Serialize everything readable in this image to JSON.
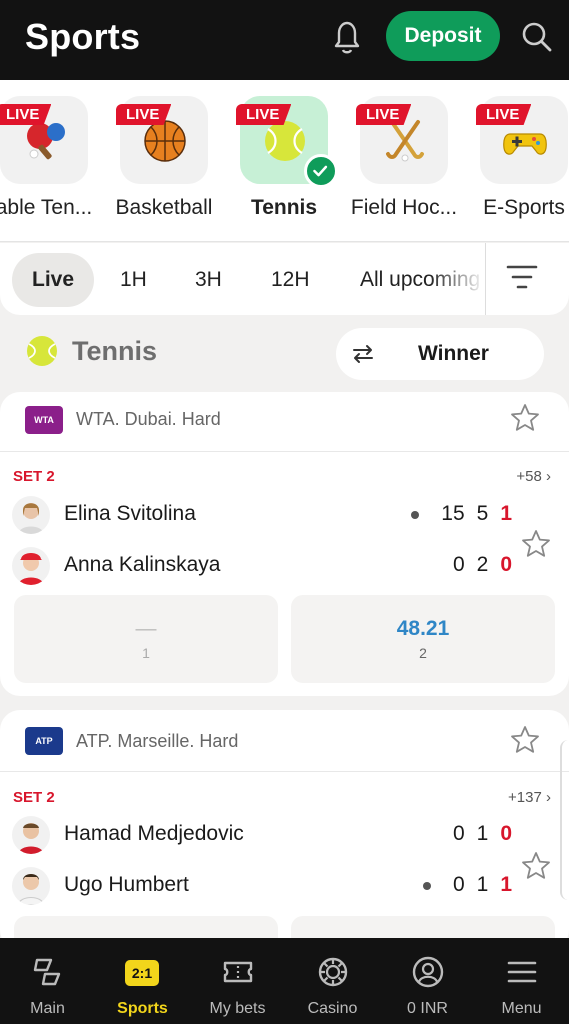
{
  "header": {
    "title": "Sports",
    "deposit_label": "Deposit"
  },
  "sports": [
    {
      "label": "Table Tennis",
      "display": "able Ten...",
      "live": "LIVE",
      "icon": "table-tennis-icon"
    },
    {
      "label": "Basketball",
      "display": "Basketball",
      "live": "LIVE",
      "icon": "basketball-icon"
    },
    {
      "label": "Tennis",
      "display": "Tennis",
      "live": "LIVE",
      "icon": "tennis-ball-icon",
      "selected": true
    },
    {
      "label": "Field Hockey",
      "display": "Field Hoc...",
      "live": "LIVE",
      "icon": "field-hockey-icon"
    },
    {
      "label": "E-Sports",
      "display": "E-Sports",
      "live": "LIVE",
      "icon": "gamepad-icon"
    }
  ],
  "time_filters": [
    {
      "label": "Live",
      "active": true
    },
    {
      "label": "1H"
    },
    {
      "label": "3H"
    },
    {
      "label": "12H"
    },
    {
      "label": "All upcoming"
    }
  ],
  "section": {
    "title": "Tennis",
    "market_label": "Winner"
  },
  "events": [
    {
      "league": "WTA. Dubai. Hard",
      "league_logo": "WTA",
      "status": "SET 2",
      "more_markets": "+58",
      "players": [
        {
          "name": "Elina Svitolina",
          "serving": true,
          "scores": [
            "15",
            "5",
            "1"
          ]
        },
        {
          "name": "Anna Kalinskaya",
          "serving": false,
          "scores": [
            "0",
            "2",
            "0"
          ]
        }
      ],
      "odds": [
        {
          "value": "—",
          "key": "1"
        },
        {
          "value": "48.21",
          "key": "2"
        }
      ]
    },
    {
      "league": "ATP. Marseille. Hard",
      "league_logo": "ATP",
      "status": "SET 2",
      "more_markets": "+137",
      "players": [
        {
          "name": "Hamad Medjedovic",
          "serving": false,
          "scores": [
            "0",
            "1",
            "0"
          ]
        },
        {
          "name": "Ugo Humbert",
          "serving": true,
          "scores": [
            "0",
            "1",
            "1"
          ]
        }
      ]
    }
  ],
  "bottom_nav": [
    {
      "label": "Main",
      "icon": "main-icon"
    },
    {
      "label": "Sports",
      "icon": "sports-2-1-icon",
      "badge": "2:1",
      "active": true
    },
    {
      "label": "My bets",
      "icon": "ticket-icon"
    },
    {
      "label": "Casino",
      "icon": "casino-chip-icon"
    },
    {
      "label": "0 INR",
      "icon": "account-icon"
    },
    {
      "label": "Menu",
      "icon": "menu-icon"
    }
  ],
  "colors": {
    "brand_green": "#0f9c5a",
    "live_red": "#e0142c",
    "odds_blue": "#2f86c6",
    "nav_active": "#f2d51b"
  }
}
